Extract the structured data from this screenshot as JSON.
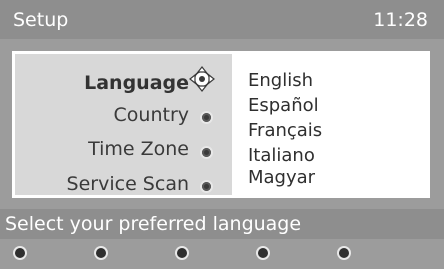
{
  "header": {
    "title": "Setup",
    "clock": "11:28"
  },
  "menu": {
    "items": [
      {
        "label": "Language",
        "selected": true
      },
      {
        "label": "Country",
        "selected": false
      },
      {
        "label": "Time Zone",
        "selected": false
      },
      {
        "label": "Service Scan",
        "selected": false
      }
    ],
    "selected_icon": "navigation-cursor-icon"
  },
  "options": [
    "English",
    "Español",
    "Français",
    "Italiano",
    "Magyar"
  ],
  "hint": "Select your preferred language",
  "color_keys": [
    "color-key-1",
    "color-key-2",
    "color-key-3",
    "color-key-4",
    "color-key-5"
  ]
}
